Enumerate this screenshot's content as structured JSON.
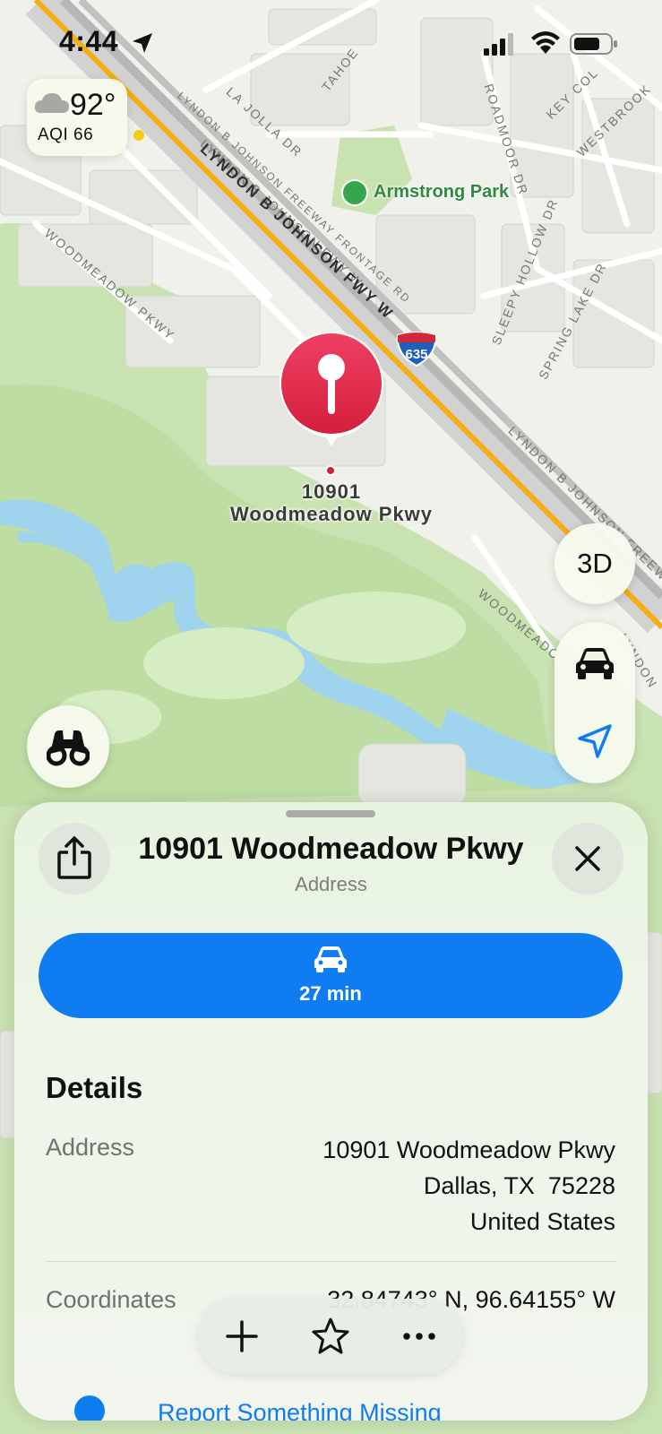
{
  "status_bar": {
    "time": "4:44"
  },
  "weather": {
    "temperature": "92°",
    "aqi": "AQI 66",
    "aqi_color": "#f3cc12",
    "icon": "cloud-icon"
  },
  "map": {
    "park": {
      "name": "Armstrong Park",
      "icon": "tree-icon"
    },
    "highway_shield": "635",
    "streets": [
      "LYNDON B JOHNSON FWY W",
      "LYNDON B JOHNSON FREEWAY FRONTAGE RD",
      "LA JOLLA DR",
      "TAHOE",
      "ROADMOOR DR",
      "KEY COL",
      "WESTBROOK",
      "SLEEPY HOLLOW DR",
      "SPRING LAKE DR",
      "WOODMEADOW PKWY",
      "LYNDON B JOHNSON FREEWA",
      "WOODMEADO",
      "LYNDON"
    ],
    "pin_label_line1": "10901",
    "pin_label_line2": "Woodmeadow Pkwy"
  },
  "controls": {
    "three_d_label": "3D"
  },
  "sheet": {
    "title": "10901 Woodmeadow Pkwy",
    "subtitle": "Address",
    "drive_time": "27 min",
    "details_heading": "Details",
    "address_label": "Address",
    "address_lines": [
      "10901 Woodmeadow Pkwy",
      "Dallas, TX  75228",
      "United States"
    ],
    "coordinates_label": "Coordinates",
    "coordinates_value": "32.84743° N, 96.64155° W",
    "report_label": "Report Something Missing"
  },
  "colors": {
    "accent": "#0f7cf1",
    "pin": "#e0264a",
    "park": "#35a64c",
    "freeway": "#f2ae12"
  }
}
